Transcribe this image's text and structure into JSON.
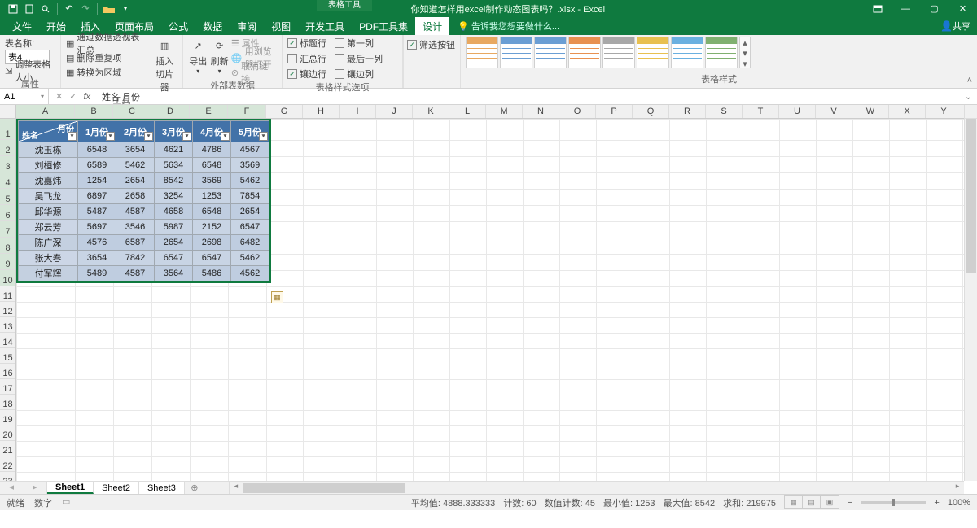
{
  "title_context_tab": "表格工具",
  "document_title": "你知道怎样用excel制作动态图表吗？.xlsx - Excel",
  "qat": [
    "save",
    "new",
    "magnifier",
    "undo",
    "redo",
    "open"
  ],
  "tabs": [
    "文件",
    "开始",
    "插入",
    "页面布局",
    "公式",
    "数据",
    "审阅",
    "视图",
    "开发工具",
    "PDF工具集",
    "设计"
  ],
  "active_tab": "设计",
  "tell_me": "告诉我您想要做什么...",
  "share_label": "共享",
  "ribbon": {
    "properties": {
      "name_label": "表名称:",
      "name_value": "表4",
      "resize": "调整表格大小",
      "group": "属性"
    },
    "tools": {
      "pivot": "通过数据透视表汇总",
      "dedup": "删除重复项",
      "convert": "转换为区域",
      "slicer": "插入\n切片器",
      "group": "工具"
    },
    "external": {
      "export": "导出",
      "refresh": "刷新",
      "props": "属性",
      "open_browser": "用浏览器打开",
      "unlink": "取消链接",
      "group": "外部表数据"
    },
    "style_opts": {
      "header_row": "标题行",
      "total_row": "汇总行",
      "banded_row": "镶边行",
      "first_col": "第一列",
      "last_col": "最后一列",
      "banded_col": "镶边列",
      "filter_btn": "筛选按钮",
      "group": "表格样式选项"
    },
    "styles": {
      "group": "表格样式"
    }
  },
  "namebox": "A1",
  "formula": "姓名    月份",
  "columns": [
    "A",
    "B",
    "C",
    "D",
    "E",
    "F",
    "G",
    "H",
    "I",
    "J",
    "K",
    "L",
    "M",
    "N",
    "O",
    "P",
    "Q",
    "R",
    "S",
    "T",
    "U",
    "V",
    "W",
    "X",
    "Y"
  ],
  "data_cols_width": 47,
  "name_col_width": 72,
  "rest_col_width": 45,
  "chart_data": {
    "type": "table",
    "header_diag_top": "月份",
    "header_diag_bottom": "姓名",
    "columns": [
      "1月份",
      "2月份",
      "3月份",
      "4月份",
      "5月份"
    ],
    "rows": [
      {
        "name": "沈玉栋",
        "values": [
          6548,
          3654,
          4621,
          4786,
          4567
        ]
      },
      {
        "name": "刘桓修",
        "values": [
          6589,
          5462,
          5634,
          6548,
          3569
        ]
      },
      {
        "name": "沈嘉炜",
        "values": [
          1254,
          2654,
          8542,
          3569,
          5462
        ]
      },
      {
        "name": "吴飞龙",
        "values": [
          6897,
          2658,
          3254,
          1253,
          7854
        ]
      },
      {
        "name": "邱华源",
        "values": [
          5487,
          4587,
          4658,
          6548,
          2654
        ]
      },
      {
        "name": "郑云芳",
        "values": [
          5697,
          3546,
          5987,
          2152,
          6547
        ]
      },
      {
        "name": "陈广深",
        "values": [
          4576,
          6587,
          2654,
          2698,
          6482
        ]
      },
      {
        "name": "张大春",
        "values": [
          3654,
          7842,
          6547,
          6547,
          5462
        ]
      },
      {
        "name": "付军辉",
        "values": [
          5489,
          4587,
          3564,
          5486,
          4562
        ]
      }
    ]
  },
  "row_count": 23,
  "sheets": [
    "Sheet1",
    "Sheet2",
    "Sheet3"
  ],
  "active_sheet": "Sheet1",
  "status": {
    "ready": "就绪",
    "num": "数字",
    "avg": "平均值: 4888.333333",
    "count": "计数: 60",
    "num_count": "数值计数: 45",
    "min": "最小值: 1253",
    "max": "最大值: 8542",
    "sum": "求和: 219975",
    "zoom": "100%"
  }
}
